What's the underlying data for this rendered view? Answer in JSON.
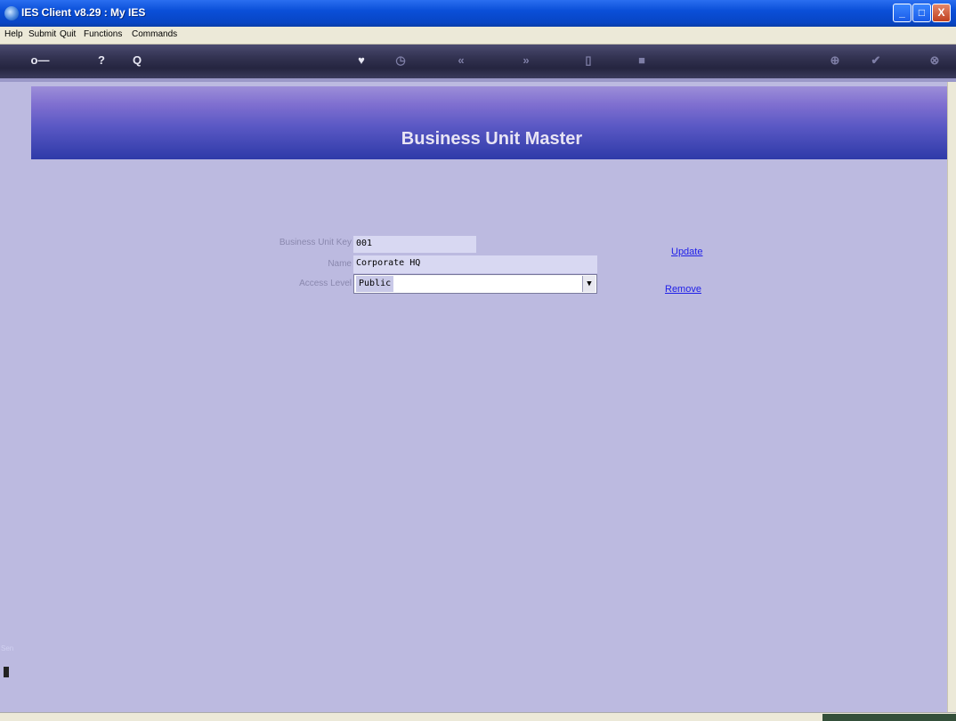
{
  "window": {
    "title": "IES Client v8.29 : My IES",
    "controls": {
      "minimize": "_",
      "maximize": "□",
      "close": "X"
    }
  },
  "menu": {
    "items": [
      "Help",
      "Submit",
      "Quit",
      "Functions",
      "Commands"
    ]
  },
  "toolbar": {
    "icons": [
      "key-icon",
      "help-icon",
      "search-icon",
      "heart-icon",
      "clock-icon",
      "back-icon",
      "forward-icon",
      "copy-icon",
      "stop-icon",
      "add-icon",
      "confirm-icon",
      "cancel-icon"
    ],
    "glyphs": {
      "key": "o—",
      "help": "?",
      "search": "Q",
      "heart": "♥",
      "clock": "◷",
      "back": "«",
      "forward": "»",
      "copy": "▯",
      "stop": "■",
      "add": "⊕",
      "confirm": "✔",
      "cancel": "⊗"
    }
  },
  "banner": {
    "title": "Business Unit Master"
  },
  "form": {
    "key_label": "Business Unit Key",
    "key_value": "001",
    "name_label": "Name",
    "name_value": "Corporate HQ",
    "access_label": "Access Level",
    "access_value": "Public"
  },
  "actions": {
    "update": "Update",
    "remove": "Remove"
  },
  "left_panel": {
    "label": "Sen"
  }
}
